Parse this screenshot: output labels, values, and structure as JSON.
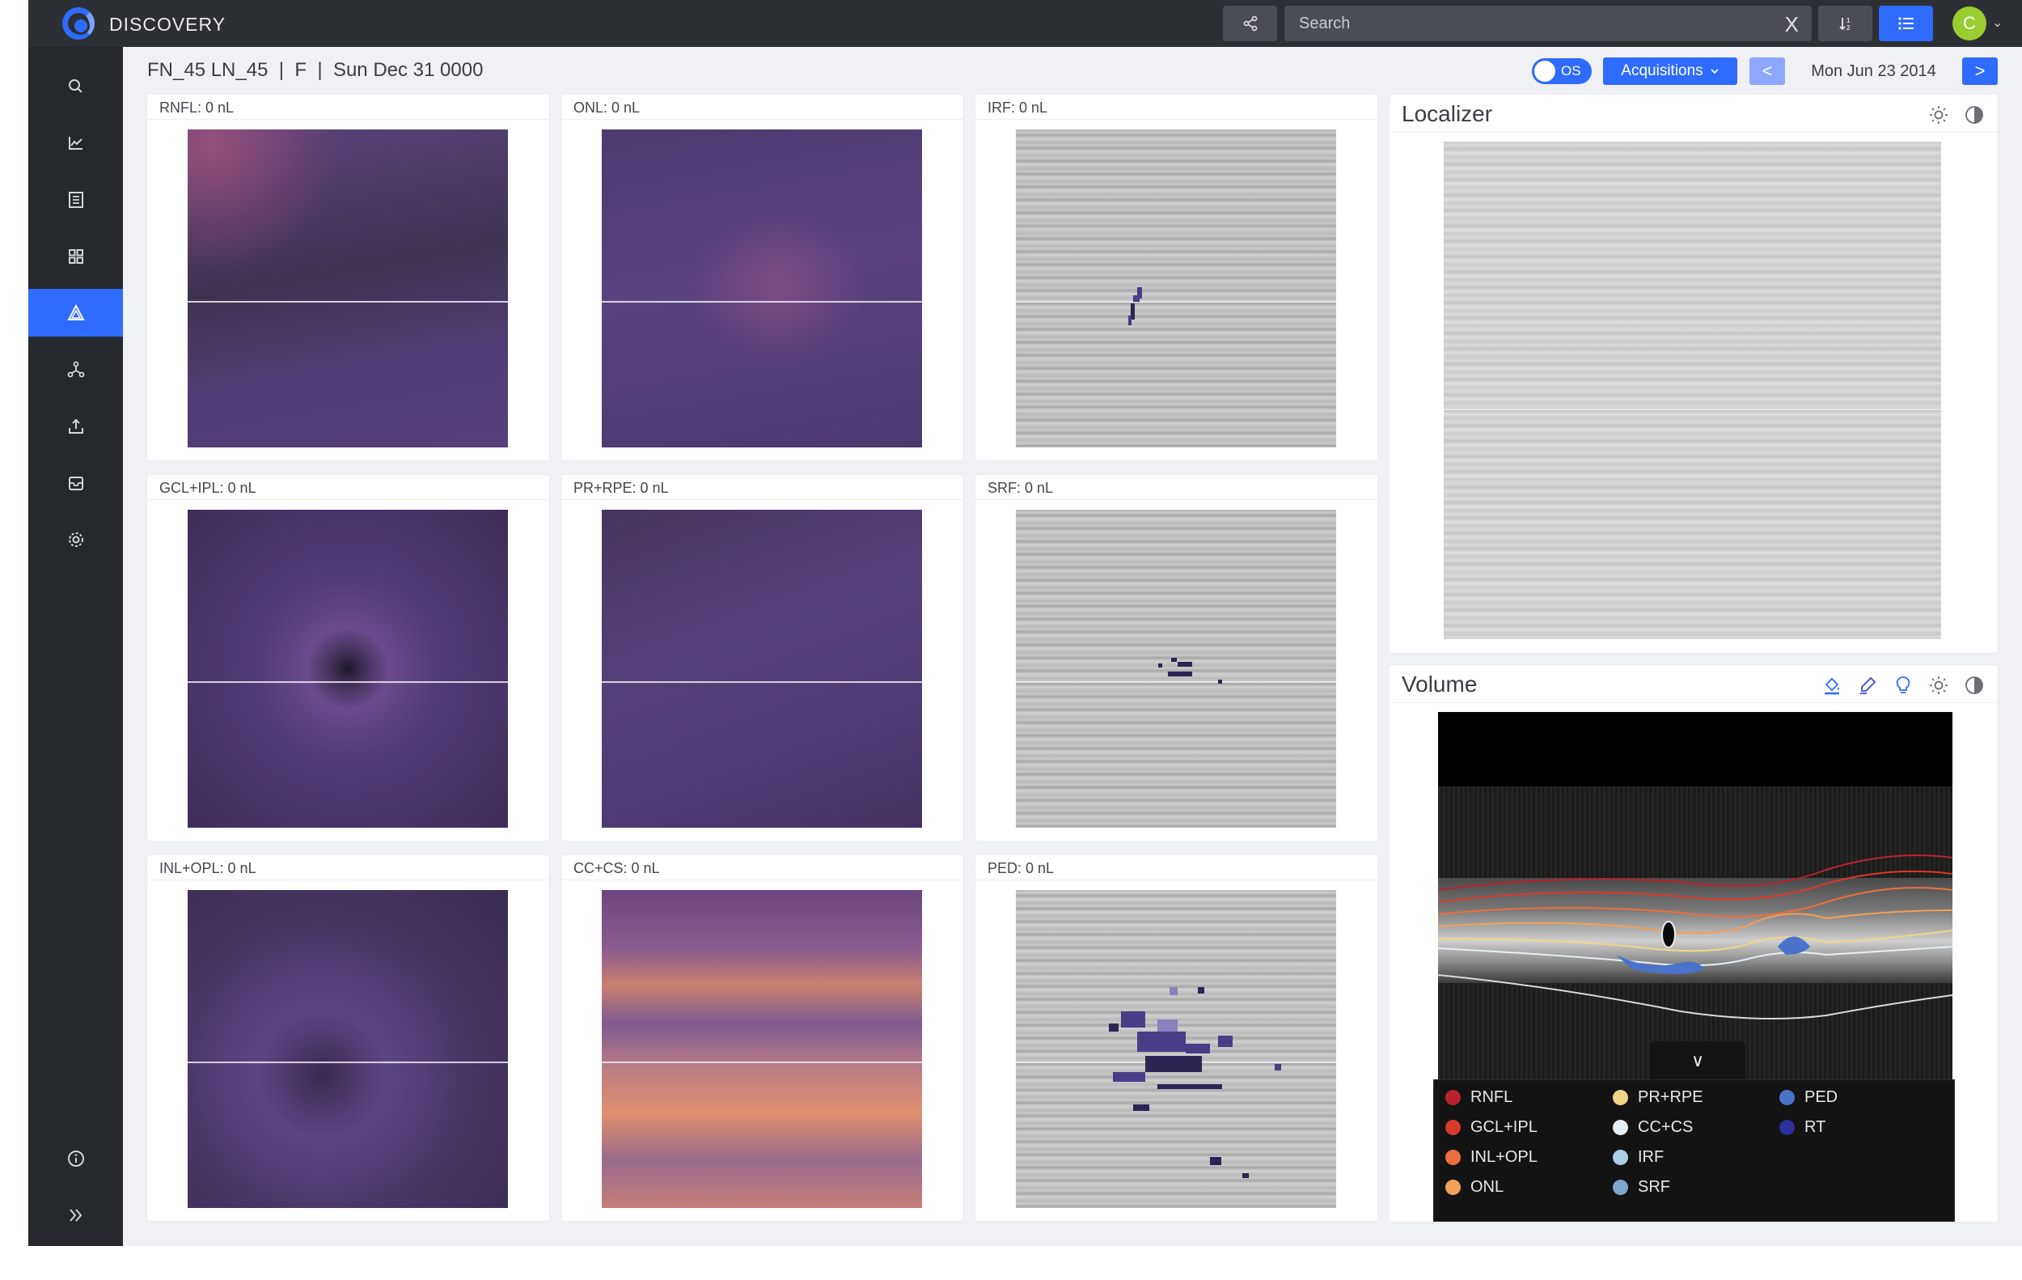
{
  "app": {
    "title": "DISCOVERY"
  },
  "topbar": {
    "search_placeholder": "Search",
    "clear_label": "X",
    "avatar_letter": "C",
    "avatar_color": "#9acd32",
    "accent": "#2f6bff"
  },
  "sidebar": {
    "items": [
      {
        "icon": "search-icon",
        "active": false
      },
      {
        "icon": "chart-icon",
        "active": false
      },
      {
        "icon": "list-icon",
        "active": false
      },
      {
        "icon": "grid-icon",
        "active": false
      },
      {
        "icon": "triangle-icon",
        "active": true
      },
      {
        "icon": "network-icon",
        "active": false
      },
      {
        "icon": "upload-icon",
        "active": false
      },
      {
        "icon": "inbox-icon",
        "active": false
      },
      {
        "icon": "gear-icon",
        "active": false
      }
    ],
    "bottom": [
      {
        "icon": "info-icon"
      },
      {
        "icon": "expand-icon"
      }
    ]
  },
  "header": {
    "patient": "FN_45 LN_45",
    "sex": "F",
    "dob": "Sun Dec 31 0000",
    "separator": "|",
    "eye": "OS",
    "acquisitions_label": "Acquisitions",
    "date": "Mon Jun 23 2014",
    "prev_label": "<",
    "next_label": ">"
  },
  "volumes": [
    {
      "label": "RNFL: 0 nL"
    },
    {
      "label": "ONL: 0 nL"
    },
    {
      "label": "IRF: 0 nL"
    },
    {
      "label": "GCL+IPL: 0 nL"
    },
    {
      "label": "PR+RPE: 0 nL"
    },
    {
      "label": "SRF: 0 nL"
    },
    {
      "label": "INL+OPL: 0 nL"
    },
    {
      "label": "CC+CS: 0 nL"
    },
    {
      "label": "PED: 0 nL"
    }
  ],
  "localizer": {
    "title": "Localizer"
  },
  "volume_panel": {
    "title": "Volume",
    "collapse_label": "∨",
    "legend": [
      {
        "label": "RNFL",
        "color": "#b8242d"
      },
      {
        "label": "PR+RPE",
        "color": "#f3d58a"
      },
      {
        "label": "PED",
        "color": "#4a73c9"
      },
      {
        "label": "GCL+IPL",
        "color": "#d83a2c"
      },
      {
        "label": "CC+CS",
        "color": "#e6eef4"
      },
      {
        "label": "RT",
        "color": "#2c2f9c"
      },
      {
        "label": "INL+OPL",
        "color": "#ec6e3f"
      },
      {
        "label": "IRF",
        "color": "#a9d0e6"
      },
      {
        "label": "ONL",
        "color": "#f1a05a"
      },
      {
        "label": "SRF",
        "color": "#7fa6cd"
      }
    ]
  }
}
